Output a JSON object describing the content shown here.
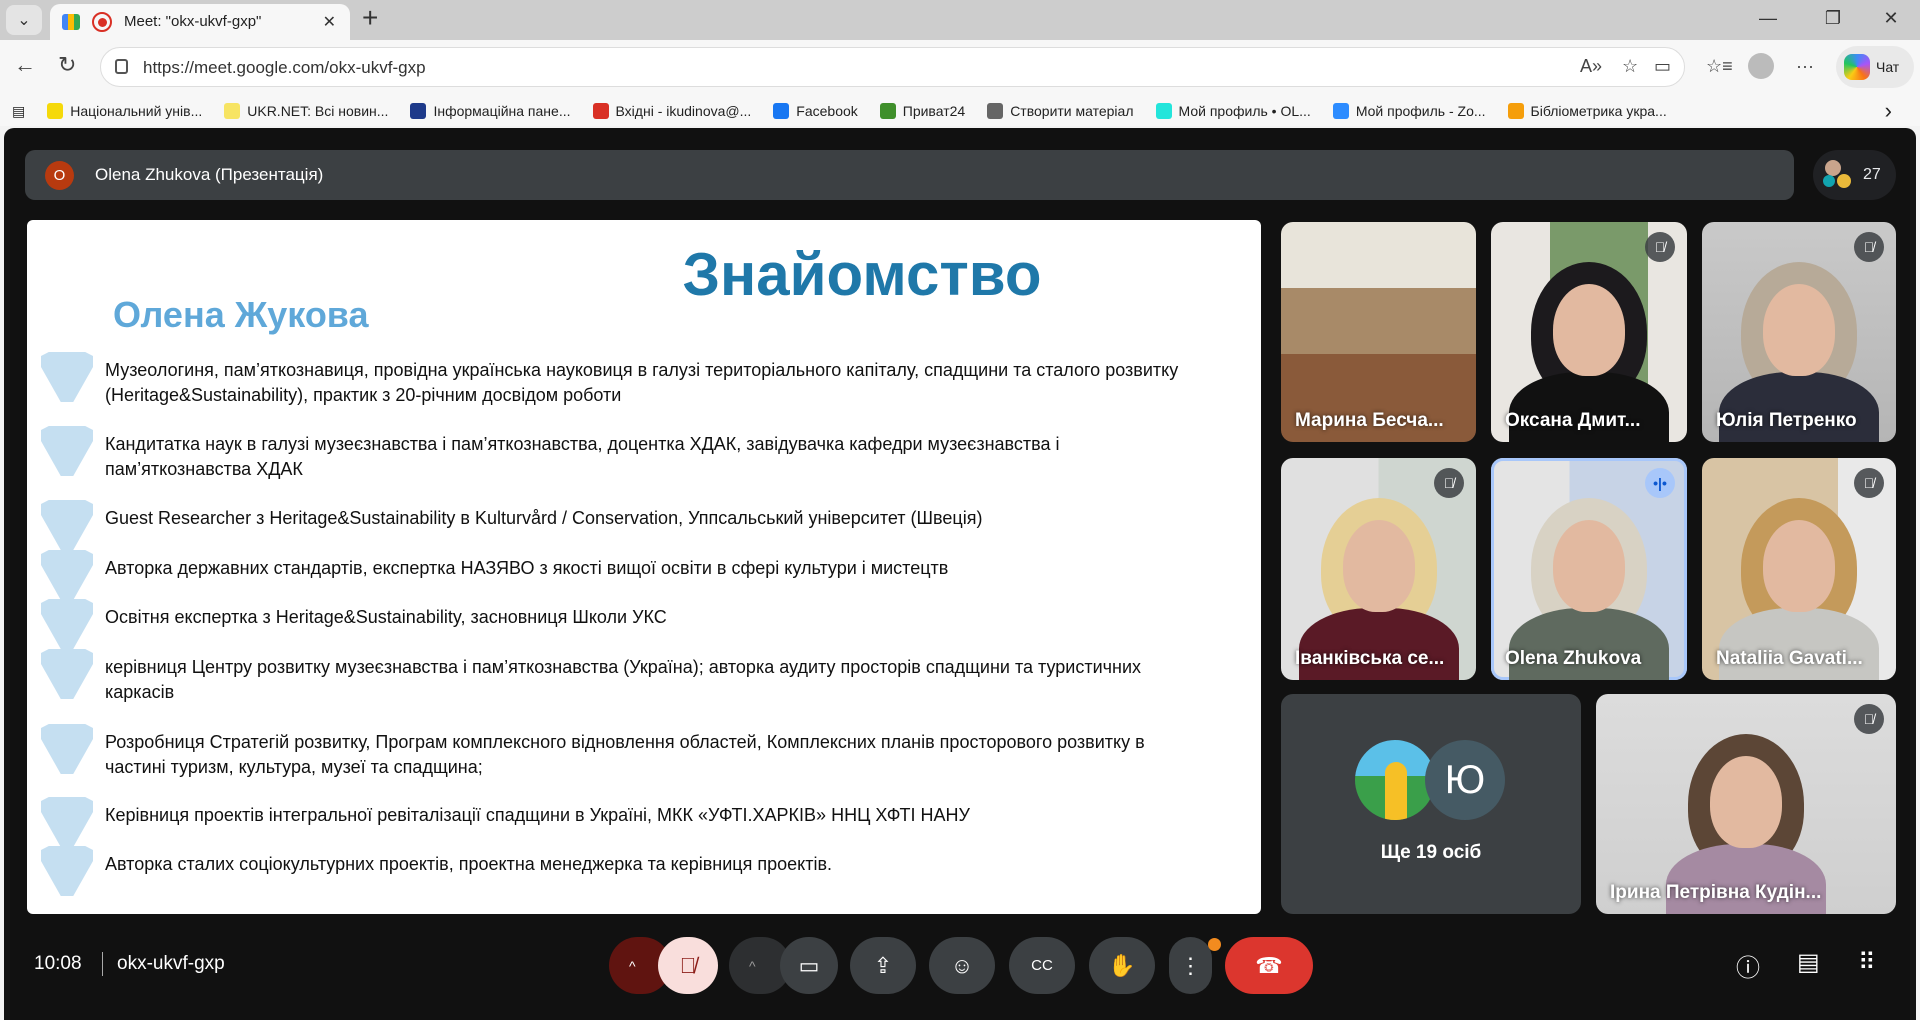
{
  "browser": {
    "tab_title": "Meet: \"okx-ukvf-gxp\"",
    "url": "https://meet.google.com/okx-ukvf-gxp",
    "chat_label": "Чат",
    "bookmarks": [
      {
        "label": "Національний унів...",
        "color": "#f5d90a"
      },
      {
        "label": "UKR.NET: Всі новин...",
        "color": "#f7e463"
      },
      {
        "label": "Інформаційна пане...",
        "color": "#1e3a8a"
      },
      {
        "label": "Вхідні - ikudinova@...",
        "color": "#d93025"
      },
      {
        "label": "Facebook",
        "color": "#1877f2"
      },
      {
        "label": "Приват24",
        "color": "#3f8f2b"
      },
      {
        "label": "Створити матеріал",
        "color": "#666666"
      },
      {
        "label": "Мой профиль • OL...",
        "color": "#23e5db"
      },
      {
        "label": "Мой профиль - Zo...",
        "color": "#2d8cff"
      },
      {
        "label": "Бібліометрика укра...",
        "color": "#f59e0b"
      }
    ]
  },
  "meet": {
    "presenter_initial": "O",
    "presenter_label": "Olena Zhukova (Презентація)",
    "participant_count": "27",
    "slide": {
      "title": "Знайомство",
      "subtitle": "Олена Жукова",
      "items": [
        [
          "Музеологиня, пам’яткознавиця, провідна українська науковиця в галузі територіального капіталу, спадщини та сталого розвитку",
          "(Heritage&Sustainability), практик з 20-річним досвідом роботи"
        ],
        [
          "Кандитатка наук в галузі музеєзнавства і пам’яткознавства, доцентка ХДАК, завідувачка кафедри музеєзнавства і",
          "пам’яткознавства ХДАК"
        ],
        [
          "Guest Researcher з Heritage&Sustainability в Kulturvård / Conservation, Уппсальський університет (Швеція)"
        ],
        [
          " Авторка державних стандартів, експертка НАЗЯВО з якості вищої освіти в сфері культури і мистецтв"
        ],
        [
          "Освітня експертка з Heritage&Sustainability, засновниця Школи УКС"
        ],
        [
          "керівниця Центру розвитку музеєзнавства і пам’яткознавства (Україна); авторка аудиту просторів спадщини та туристичних",
          "каркасів"
        ],
        [
          "Розробниця Стратегій розвитку, Програм комплексного відновлення областей, Комплексних планів просторового розвитку в",
          "частині туризм, культура, музеї та спадщина;"
        ],
        [
          "Керівниця проектів інтегральної ревіталізації спадщини в Україні, МКК «УФТІ.ХАРКІВ» ННЦ ХФТІ НАНУ"
        ],
        [
          "Авторка сталих соціокультурних проектів, проектна менеджерка та керівниця проектів."
        ]
      ]
    },
    "tiles": [
      {
        "name": "Марина Бесча...",
        "muted": false
      },
      {
        "name": "Оксана Дмит...",
        "muted": true
      },
      {
        "name": "Юлія Петренко",
        "muted": true
      },
      {
        "name": "Іванківська се...",
        "muted": true
      },
      {
        "name": "Olena Zhukova",
        "muted": false,
        "speaking": true
      },
      {
        "name": "Nataliia Gavati...",
        "muted": true
      },
      {
        "name": "Ірина Петрівна Кудін...",
        "muted": true
      }
    ],
    "more_tile": {
      "avatar_letter": "Ю",
      "label": "Ще 19 осіб"
    },
    "clock": "10:08",
    "meeting_code": "okx-ukvf-gxp"
  }
}
